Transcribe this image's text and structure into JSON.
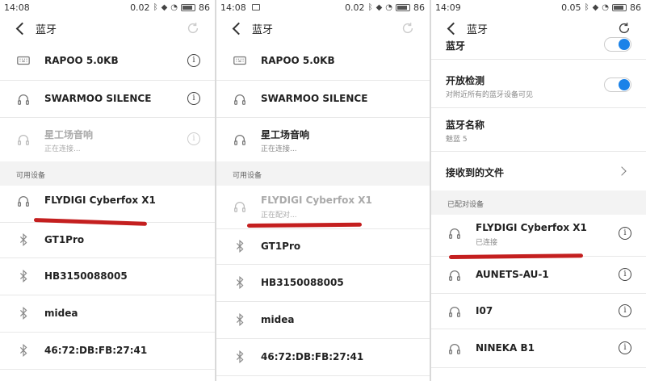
{
  "screen1": {
    "status": {
      "time": "14:08",
      "speed": "0.02",
      "battery": "86"
    },
    "title": "蓝牙",
    "paired": [
      {
        "name": "RAPOO 5.0KB",
        "icon": "keyboard-icon"
      },
      {
        "name": "SWARMOO SILENCE",
        "icon": "headphones-icon"
      },
      {
        "name": "星工场音响",
        "sub": "正在连接...",
        "icon": "headphones-icon",
        "dim": true
      }
    ],
    "available_header": "可用设备",
    "available": [
      {
        "name": "FLYDIGI Cyberfox X1",
        "icon": "headphones-icon"
      },
      {
        "name": "GT1Pro",
        "icon": "bluetooth-icon"
      },
      {
        "name": "HB3150088005",
        "icon": "bluetooth-icon"
      },
      {
        "name": "midea",
        "icon": "bluetooth-icon"
      },
      {
        "name": "46:72:DB:FB:27:41",
        "icon": "bluetooth-icon"
      }
    ]
  },
  "screen2": {
    "status": {
      "time": "14:08",
      "speed": "0.02",
      "battery": "86"
    },
    "title": "蓝牙",
    "paired": [
      {
        "name": "RAPOO 5.0KB",
        "icon": "keyboard-icon"
      },
      {
        "name": "SWARMOO SILENCE",
        "icon": "headphones-icon"
      },
      {
        "name": "星工场音响",
        "sub": "正在连接...",
        "icon": "headphones-icon"
      }
    ],
    "available_header": "可用设备",
    "available": [
      {
        "name": "FLYDIGI Cyberfox X1",
        "sub": "正在配对...",
        "icon": "headphones-icon",
        "dim": true
      },
      {
        "name": "GT1Pro",
        "icon": "bluetooth-icon"
      },
      {
        "name": "HB3150088005",
        "icon": "bluetooth-icon"
      },
      {
        "name": "midea",
        "icon": "bluetooth-icon"
      },
      {
        "name": "46:72:DB:FB:27:41",
        "icon": "bluetooth-icon"
      }
    ]
  },
  "screen3": {
    "status": {
      "time": "14:09",
      "speed": "0.05",
      "battery": "86"
    },
    "title": "蓝牙",
    "settings": {
      "bluetooth_label": "蓝牙",
      "open_detect_label": "开放检测",
      "open_detect_sub": "对附近所有的蓝牙设备可见",
      "name_label": "蓝牙名称",
      "name_value": "魅蓝 5",
      "received_files_label": "接收到的文件"
    },
    "paired_header": "已配对设备",
    "paired": [
      {
        "name": "FLYDIGI Cyberfox X1",
        "sub": "已连接",
        "icon": "headphones-icon"
      },
      {
        "name": "AUNETS-AU-1",
        "icon": "headphones-icon"
      },
      {
        "name": "I07",
        "icon": "headphones-icon"
      },
      {
        "name": "NINEKA B1",
        "icon": "headphones-icon"
      }
    ]
  },
  "colors": {
    "accent": "#1a82e8",
    "annotation": "#c41f1f",
    "section_bg": "#f3f3f3"
  }
}
